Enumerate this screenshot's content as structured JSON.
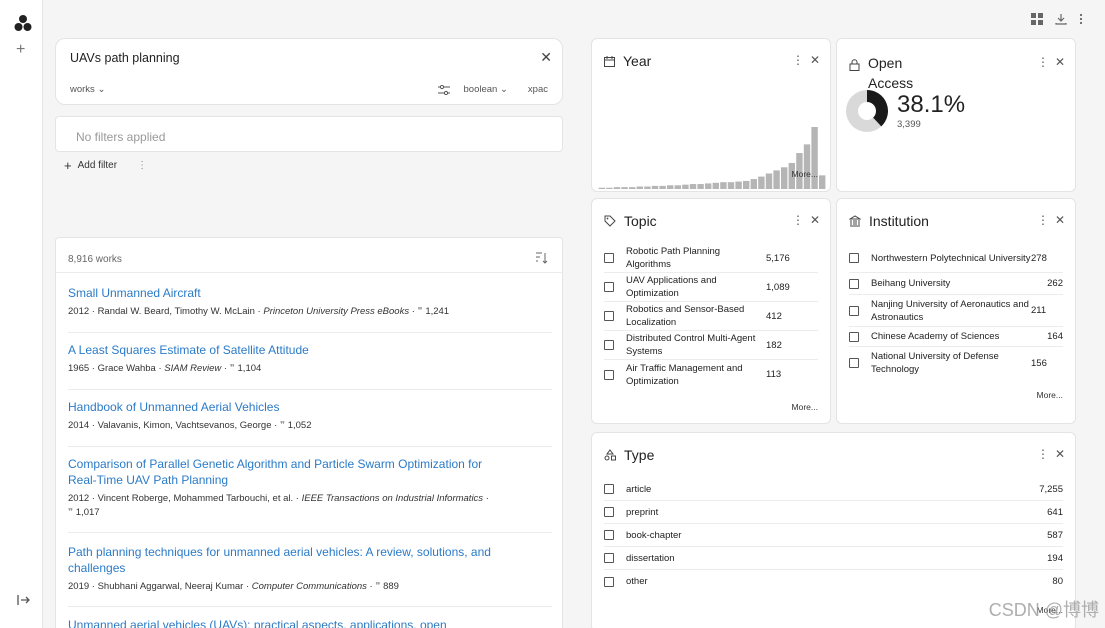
{
  "search": {
    "query": "UAVs path planning",
    "entity": "works",
    "mode": "boolean",
    "xpac": "xpac"
  },
  "filters": {
    "empty_text": "No filters applied",
    "add_label": "Add filter"
  },
  "results": {
    "count_label": "8,916 works",
    "items": [
      {
        "title": "Small Unmanned Aircraft",
        "meta_pre": "2012 · Randal W. Beard, Timothy W. McLain · ",
        "venue": "Princeton University Press eBooks",
        "cites": "1,241"
      },
      {
        "title": "A Least Squares Estimate of Satellite Attitude",
        "meta_pre": "1965 · Grace Wahba · ",
        "venue": "SIAM Review",
        "cites": "1,104"
      },
      {
        "title": "Handbook of Unmanned Aerial Vehicles",
        "meta_pre": "2014 · Valavanis, Kimon, Vachtsevanos, George · ",
        "venue": "",
        "cites": "1,052"
      },
      {
        "title": "Comparison of Parallel Genetic Algorithm and Particle Swarm Optimization for Real-Time UAV Path Planning",
        "meta_pre": "2012 · Vincent Roberge, Mohammed Tarbouchi, et al. · ",
        "venue": "IEEE Transactions on Industrial Informatics",
        "cites": "1,017"
      },
      {
        "title": "Path planning techniques for unmanned aerial vehicles: A review, solutions, and challenges",
        "meta_pre": "2019 · Shubhani Aggarwal, Neeraj Kumar · ",
        "venue": "Computer Communications",
        "cites": "889"
      },
      {
        "title": "Unmanned aerial vehicles (UAVs): practical aspects, applications, open",
        "meta_pre": "",
        "venue": "",
        "cites": ""
      }
    ]
  },
  "year": {
    "label": "Year",
    "more": "More...",
    "bar_values": [
      0.02,
      0.02,
      0.03,
      0.03,
      0.03,
      0.04,
      0.04,
      0.05,
      0.05,
      0.06,
      0.06,
      0.07,
      0.08,
      0.08,
      0.09,
      0.1,
      0.11,
      0.11,
      0.12,
      0.13,
      0.16,
      0.2,
      0.25,
      0.3,
      0.35,
      0.42,
      0.58,
      0.72,
      1.0,
      0.22
    ]
  },
  "open_access": {
    "label_line1": "Open",
    "label_line2": "Access",
    "percent": "38.1%",
    "count": "3,399",
    "fraction": 0.381
  },
  "topic": {
    "label": "Topic",
    "more": "More...",
    "rows": [
      {
        "label": "Robotic Path Planning Algorithms",
        "count": "5,176"
      },
      {
        "label": "UAV Applications and Optimization",
        "count": "1,089"
      },
      {
        "label": "Robotics and Sensor-Based Localization",
        "count": "412"
      },
      {
        "label": "Distributed Control Multi-Agent Systems",
        "count": "182"
      },
      {
        "label": "Air Traffic Management and Optimization",
        "count": "113"
      }
    ]
  },
  "institution": {
    "label": "Institution",
    "more": "More...",
    "rows": [
      {
        "label": "Northwestern Polytechnical University",
        "count": "278"
      },
      {
        "label": "Beihang University",
        "count": "262"
      },
      {
        "label": "Nanjing University of Aeronautics and Astronautics",
        "count": "211"
      },
      {
        "label": "Chinese Academy of Sciences",
        "count": "164"
      },
      {
        "label": "National University of Defense Technology",
        "count": "156"
      }
    ]
  },
  "type": {
    "label": "Type",
    "more": "More...",
    "rows": [
      {
        "label": "article",
        "count": "7,255"
      },
      {
        "label": "preprint",
        "count": "641"
      },
      {
        "label": "book-chapter",
        "count": "587"
      },
      {
        "label": "dissertation",
        "count": "194"
      },
      {
        "label": "other",
        "count": "80"
      }
    ]
  },
  "watermark": "CSDN @博博"
}
